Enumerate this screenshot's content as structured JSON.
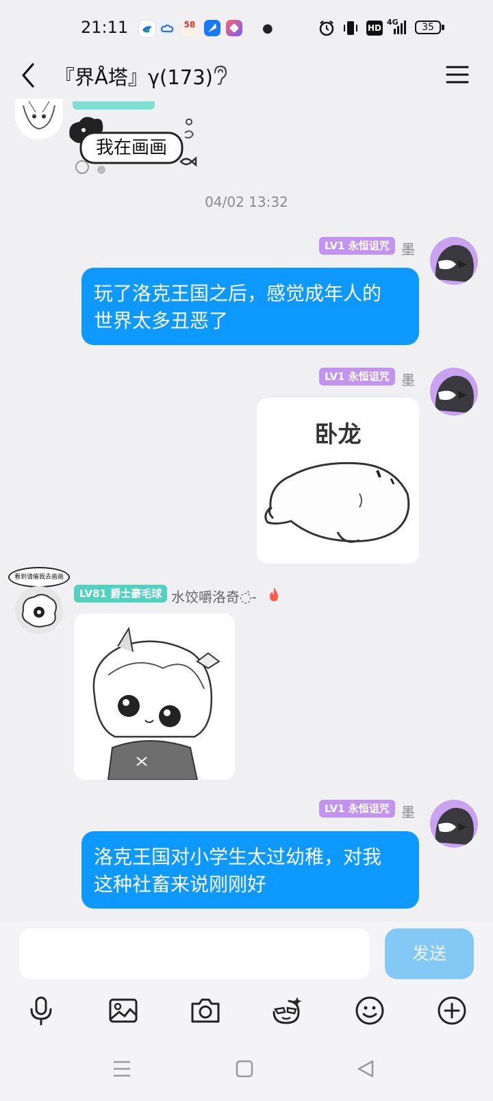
{
  "status_bar": {
    "time": "21:11",
    "app_badge_58": "58",
    "network": "4G",
    "hd": "HD",
    "battery": "35"
  },
  "header": {
    "title": "『界Å塔』γ(173)",
    "back_icon": "chevron-left-icon",
    "menu_icon": "hamburger-icon"
  },
  "messages": [
    {
      "sender": "top-user",
      "type": "sticker",
      "content": "我在画画"
    },
    {
      "type": "timestamp",
      "content": "04/02 13:32"
    },
    {
      "sender": "墨",
      "badge": "LV1 永恒诅咒",
      "type": "text",
      "side": "right",
      "content_lines": [
        "玩了洛克王国之后，感觉成年人的",
        "世界太多丑恶了"
      ]
    },
    {
      "sender": "墨",
      "badge": "LV1 永恒诅咒",
      "type": "image",
      "side": "right",
      "caption": "卧龙"
    },
    {
      "sender": "水饺嚼洛奇",
      "sender_suffix": "◌̇-",
      "badge": "LV81 爵士豪毛球",
      "avatar_bubble": "看到请催我去画画",
      "type": "image",
      "side": "left"
    },
    {
      "sender": "墨",
      "badge": "LV1 永恒诅咒",
      "type": "text",
      "side": "right",
      "content_lines": [
        "洛克王国对小学生太过幼稚，对我",
        "这种社畜来说刚刚好"
      ]
    }
  ],
  "input": {
    "value": "",
    "placeholder": "",
    "send_label": "发送"
  },
  "toolbar": [
    "mic-icon",
    "image-icon",
    "camera-icon",
    "emoji-mask-icon",
    "smiley-icon",
    "plus-icon"
  ],
  "nav": [
    "menu-nav-icon",
    "home-nav-icon",
    "back-nav-icon"
  ],
  "colors": {
    "bubble": "#0d99ff",
    "badge_purple": "#c294f0",
    "badge_teal": "#52d1c0",
    "send_disabled": "#84c9f6"
  }
}
